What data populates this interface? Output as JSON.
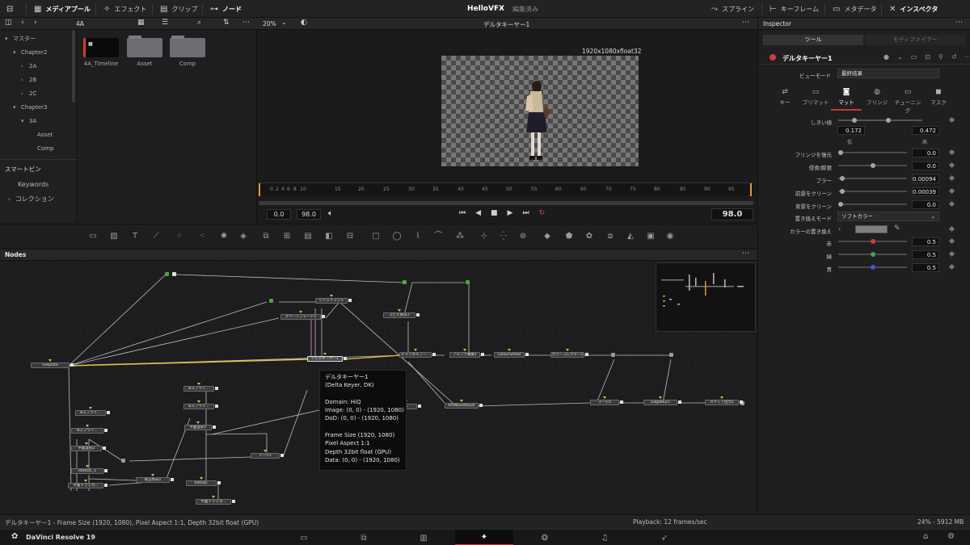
{
  "topbar": {
    "media_pool": "メディアプール",
    "effects": "エフェクト",
    "clips": "クリップ",
    "nodes": "ノード",
    "project_title": "HelloVFX",
    "project_status": "編集済み",
    "spline": "スプライン",
    "keyframes": "キーフレーム",
    "metadata": "メタデータ",
    "inspector": "インスペクタ"
  },
  "media_pool": {
    "current_bin": "4A",
    "bins": [
      {
        "label": "マスター",
        "indent": 0,
        "arrow": "▾"
      },
      {
        "label": "Chapter2",
        "indent": 1,
        "arrow": "▾"
      },
      {
        "label": "2A",
        "indent": 2,
        "arrow": "›"
      },
      {
        "label": "2B",
        "indent": 2,
        "arrow": "›"
      },
      {
        "label": "2C",
        "indent": 2,
        "arrow": "›"
      },
      {
        "label": "Chapter3",
        "indent": 1,
        "arrow": "▾"
      },
      {
        "label": "3A",
        "indent": 2,
        "arrow": "▾"
      },
      {
        "label": "Asset",
        "indent": 3,
        "arrow": ""
      },
      {
        "label": "Comp",
        "indent": 3,
        "arrow": ""
      }
    ],
    "smart_bins_title": "スマートビン",
    "smart_bins": [
      "Keywords",
      "コレクション"
    ],
    "clips": [
      "4A_Timeline",
      "Asset",
      "Comp"
    ]
  },
  "viewer": {
    "zoom": "20%",
    "title": "デルタキーヤー1",
    "format": "1920x1080xfloat32",
    "ruler_ticks": [
      "0",
      "2",
      "4",
      "6",
      "8",
      "10",
      "15",
      "20",
      "25",
      "30",
      "35",
      "40",
      "45",
      "50",
      "55",
      "60",
      "65",
      "70",
      "75",
      "80",
      "85",
      "90",
      "95"
    ],
    "start": "0.0",
    "end": "98.0",
    "current": "98.0"
  },
  "nodes_panel": {
    "title": "Nodes",
    "nodes": {
      "liveplate": "liveplate",
      "solid_matte": "ソリッドマット",
      "clean_plate": "クリーンプレート1",
      "delta_keyer": "デルタキーヤー1",
      "spill": "スピル除去1",
      "channel_bool": "チャンネルブー...",
      "alpha_divide": "アルファ乗算1",
      "colour_smear": "ColourSmear",
      "color_corrector": "カラーコレクター1",
      "bspline1": "Bスプライ...",
      "bspline2": "Bスプライ...",
      "bspline3": "Bスプライ...",
      "bspline4": "Bスプライ...",
      "plane_transform1": "平面変形2",
      "plane_transform2": "平面変形1",
      "roto_qc1": "RotoQC_1",
      "roto_qc2": "RotoQC",
      "planar_tracker1": "平面トラッカ...",
      "planar_tracker2": "平面トラッカ...",
      "trim_sub": "修正除去1",
      "merge1": "マージ1",
      "merge2": "マージ2",
      "cc": "CC",
      "add_noise": "AddNoiseKeyer",
      "edge_blur": "EdgeBlur1",
      "media_out": "メディア出力1"
    },
    "tooltip": [
      "デルタキーヤー1",
      "(Delta Keyer, DK)",
      "",
      "Domain: HiQ",
      "  Image: (0, 0) - (1920, 1080)",
      "  DoD: (0, 0) - (1920, 1080)",
      "",
      "Frame Size (1920, 1080)",
      "Pixel Aspect 1:1",
      "Depth 32bit float (GPU)",
      "Data: (0, 0) - (1920, 1080)"
    ]
  },
  "inspector": {
    "title": "Inspector",
    "tab_tools": "ツール",
    "tab_modifiers": "モディファイアー",
    "node_name": "デルタキーヤー1",
    "view_mode_label": "ビューモード",
    "view_mode_value": "最終結果",
    "tabs": [
      "キー",
      "プリマット",
      "マット",
      "フリンジ",
      "チューニング",
      "マスク"
    ],
    "active_tab": "マット",
    "threshold_label": "しきい値",
    "threshold_low": "0.172",
    "threshold_high": "0.472",
    "threshold_low_label": "低",
    "threshold_high_label": "高",
    "params": [
      {
        "label": "フリンジを復元",
        "value": "0.0",
        "knob": 0.0
      },
      {
        "label": "侵食/膨張",
        "value": "0.0",
        "knob": 0.5
      },
      {
        "label": "ブラー",
        "value": "0.00094",
        "knob": 0.03
      },
      {
        "label": "前景をクリーン",
        "value": "0.00039",
        "knob": 0.02
      },
      {
        "label": "背景をクリーン",
        "value": "0.0",
        "knob": 0.0
      }
    ],
    "replace_mode_label": "置き換えモード",
    "replace_mode_value": "ソフトカラー",
    "replace_color_label": "カラーの置き換え",
    "rgb": [
      {
        "label": "赤",
        "value": "0.5",
        "color": "#d23a3a"
      },
      {
        "label": "緑",
        "value": "0.5",
        "color": "#3aa83a"
      },
      {
        "label": "青",
        "value": "0.5",
        "color": "#3a5ad2"
      }
    ]
  },
  "status": {
    "left": "デルタキーヤー1 - Frame Size (1920, 1080), Pixel Aspect 1:1, Depth 32bit float (GPU)",
    "playback": "Playback: 12 frames/sec",
    "memory": "24% - 5912 MB"
  },
  "pagebar": {
    "app_name": "DaVinci Resolve 19"
  }
}
